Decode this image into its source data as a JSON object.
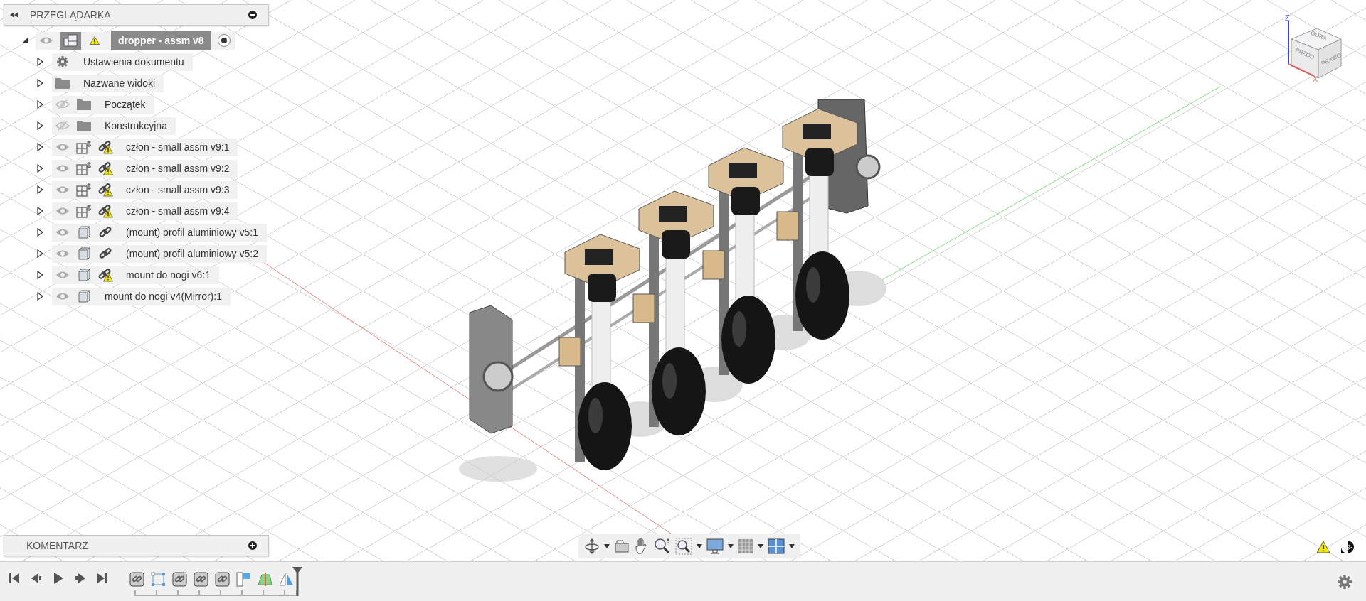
{
  "browser": {
    "title": "PRZEGLĄDARKA",
    "root": {
      "label": "dropper - assm v8",
      "expanded": true,
      "visible": true,
      "warning": true,
      "children": [
        {
          "label": "Ustawienia dokumentu",
          "kind": "settings",
          "expanded": false
        },
        {
          "label": "Nazwane widoki",
          "kind": "folder",
          "expanded": false
        },
        {
          "label": "Początek",
          "kind": "folder",
          "visible": false,
          "expanded": false
        },
        {
          "label": "Konstrukcyjna",
          "kind": "folder",
          "visible": false,
          "expanded": false
        },
        {
          "label": "człon - small assm v9:1",
          "kind": "subassembly",
          "visible": true,
          "linked": true,
          "link_warning": true,
          "expanded": false
        },
        {
          "label": "człon - small assm v9:2",
          "kind": "subassembly",
          "visible": true,
          "linked": true,
          "link_warning": true,
          "expanded": false
        },
        {
          "label": "człon - small assm v9:3",
          "kind": "subassembly",
          "visible": true,
          "linked": true,
          "link_warning": true,
          "expanded": false
        },
        {
          "label": "człon - small assm v9:4",
          "kind": "subassembly",
          "visible": true,
          "linked": true,
          "link_warning": true,
          "expanded": false
        },
        {
          "label": "(mount) profil aluminiowy v5:1",
          "kind": "body",
          "visible": true,
          "linked": true,
          "link_warning": false,
          "expanded": false
        },
        {
          "label": "(mount) profil aluminiowy v5:2",
          "kind": "body",
          "visible": true,
          "linked": true,
          "link_warning": false,
          "expanded": false
        },
        {
          "label": "mount do nogi v6:1",
          "kind": "body",
          "visible": true,
          "linked": true,
          "link_warning": true,
          "expanded": false
        },
        {
          "label": "mount do nogi v4(Mirror):1",
          "kind": "body",
          "visible": true,
          "linked": false,
          "expanded": false
        }
      ]
    }
  },
  "comments": {
    "title": "KOMENTARZ"
  },
  "viewcube": {
    "top": "GÓRA",
    "front": "PRZÓD",
    "right": "PRAWO",
    "z_axis": "Z",
    "x_axis": "X"
  },
  "timeline": {
    "features": [
      {
        "kind": "joint"
      },
      {
        "kind": "sketch"
      },
      {
        "kind": "joint"
      },
      {
        "kind": "joint"
      },
      {
        "kind": "joint"
      },
      {
        "kind": "plane"
      },
      {
        "kind": "split"
      },
      {
        "kind": "mirror"
      }
    ]
  }
}
